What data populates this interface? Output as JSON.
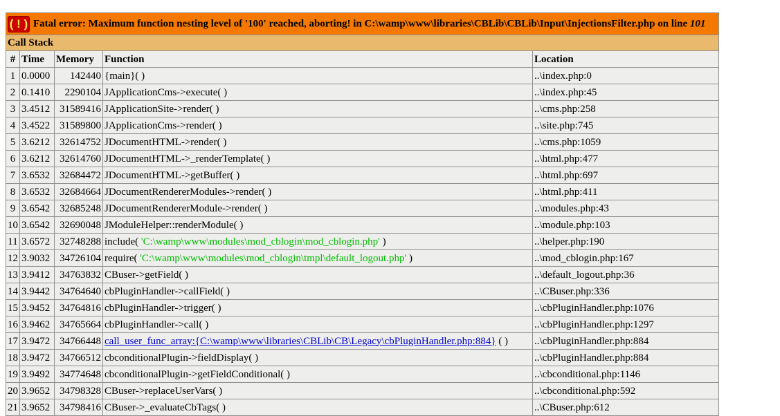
{
  "error": {
    "badge": "( ! )",
    "message_prefix": "Fatal error: Maximum function nesting level of '100' reached, aborting! in C:\\wamp\\www\\libraries\\CBLib\\CBLib\\Input\\InjectionsFilter.php on line ",
    "line": "101"
  },
  "call_stack_title": "Call Stack",
  "headers": {
    "num": "#",
    "time": "Time",
    "memory": "Memory",
    "function": "Function",
    "location": "Location"
  },
  "rows": [
    {
      "num": "1",
      "time": "0.0000",
      "memory": "142440",
      "func": "{main}( )",
      "location": "..\\index.php:0"
    },
    {
      "num": "2",
      "time": "0.1410",
      "memory": "2290104",
      "func": "JApplicationCms->execute( )",
      "location": "..\\index.php:45"
    },
    {
      "num": "3",
      "time": "3.4512",
      "memory": "31589416",
      "func": "JApplicationSite->render( )",
      "location": "..\\cms.php:258"
    },
    {
      "num": "4",
      "time": "3.4522",
      "memory": "31589800",
      "func": "JApplicationCms->render( )",
      "location": "..\\site.php:745"
    },
    {
      "num": "5",
      "time": "3.6212",
      "memory": "32614752",
      "func": "JDocumentHTML->render( )",
      "location": "..\\cms.php:1059"
    },
    {
      "num": "6",
      "time": "3.6212",
      "memory": "32614760",
      "func": "JDocumentHTML->_renderTemplate( )",
      "location": "..\\html.php:477"
    },
    {
      "num": "7",
      "time": "3.6532",
      "memory": "32684472",
      "func": "JDocumentHTML->getBuffer( )",
      "location": "..\\html.php:697"
    },
    {
      "num": "8",
      "time": "3.6532",
      "memory": "32684664",
      "func": "JDocumentRendererModules->render( )",
      "location": "..\\html.php:411"
    },
    {
      "num": "9",
      "time": "3.6542",
      "memory": "32685248",
      "func": "JDocumentRendererModule->render( )",
      "location": "..\\modules.php:43"
    },
    {
      "num": "10",
      "time": "3.6542",
      "memory": "32690048",
      "func": "JModuleHelper::renderModule( )",
      "location": "..\\module.php:103"
    },
    {
      "num": "11",
      "time": "3.6572",
      "memory": "32748288",
      "func_pre": "include( ",
      "func_str": "'C:\\wamp\\www\\modules\\mod_cblogin\\mod_cblogin.php'",
      "func_post": " )",
      "location": "..\\helper.php:190"
    },
    {
      "num": "12",
      "time": "3.9032",
      "memory": "34726104",
      "func_pre": "require( ",
      "func_str": "'C:\\wamp\\www\\modules\\mod_cblogin\\tmpl\\default_logout.php'",
      "func_post": " )",
      "location": "..\\mod_cblogin.php:167"
    },
    {
      "num": "13",
      "time": "3.9412",
      "memory": "34763832",
      "func": "CBuser->getField( )",
      "location": "..\\default_logout.php:36"
    },
    {
      "num": "14",
      "time": "3.9442",
      "memory": "34764640",
      "func": "cbPluginHandler->callField( )",
      "location": "..\\CBuser.php:336"
    },
    {
      "num": "15",
      "time": "3.9452",
      "memory": "34764816",
      "func": "cbPluginHandler->trigger( )",
      "location": "..\\cbPluginHandler.php:1076"
    },
    {
      "num": "16",
      "time": "3.9462",
      "memory": "34765664",
      "func": "cbPluginHandler->call( )",
      "location": "..\\cbPluginHandler.php:1297"
    },
    {
      "num": "17",
      "time": "3.9472",
      "memory": "34766448",
      "func_link": "call_user_func_array:{C:\\wamp\\www\\libraries\\CBLib\\CB\\Legacy\\cbPluginHandler.php:884}",
      "func_post": " ( )",
      "location": "..\\cbPluginHandler.php:884"
    },
    {
      "num": "18",
      "time": "3.9472",
      "memory": "34766512",
      "func": "cbconditionalPlugin->fieldDisplay( )",
      "location": "..\\cbPluginHandler.php:884"
    },
    {
      "num": "19",
      "time": "3.9492",
      "memory": "34774648",
      "func": "cbconditionalPlugin->getFieldConditional( )",
      "location": "..\\cbconditional.php:1146"
    },
    {
      "num": "20",
      "time": "3.9652",
      "memory": "34798328",
      "func": "CBuser->replaceUserVars( )",
      "location": "..\\cbconditional.php:592"
    },
    {
      "num": "21",
      "time": "3.9652",
      "memory": "34798416",
      "func": "CBuser->_evaluateCbTags( )",
      "location": "..\\CBuser.php:612"
    }
  ]
}
